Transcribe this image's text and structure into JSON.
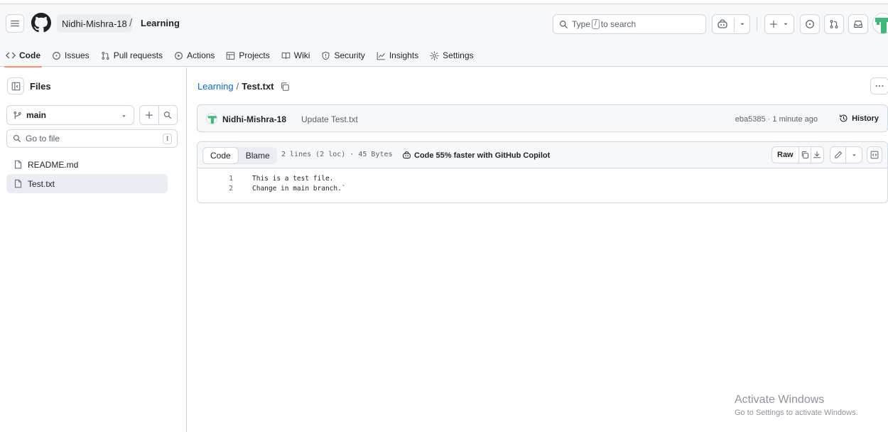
{
  "header": {
    "owner": "Nidhi-Mishra-18",
    "separator": "/",
    "repo": "Learning",
    "search": {
      "prefix": "Type",
      "key": "/",
      "suffix": "to search"
    },
    "icons": [
      "hamburger-icon",
      "github-logo",
      "search-icon",
      "copilot-icon",
      "plus-icon",
      "issue-icon",
      "pull-request-icon",
      "inbox-icon"
    ]
  },
  "tabs": [
    {
      "label": "Code",
      "icon": "code-icon",
      "active": true
    },
    {
      "label": "Issues",
      "icon": "issue-icon"
    },
    {
      "label": "Pull requests",
      "icon": "pull-request-icon"
    },
    {
      "label": "Actions",
      "icon": "play-icon"
    },
    {
      "label": "Projects",
      "icon": "table-icon"
    },
    {
      "label": "Wiki",
      "icon": "book-icon"
    },
    {
      "label": "Security",
      "icon": "shield-icon"
    },
    {
      "label": "Insights",
      "icon": "graph-icon"
    },
    {
      "label": "Settings",
      "icon": "gear-icon"
    }
  ],
  "sidebar": {
    "title": "Files",
    "branch": "main",
    "goto_placeholder": "Go to file",
    "goto_key": "t",
    "files": [
      {
        "name": "README.md",
        "selected": false
      },
      {
        "name": "Test.txt",
        "selected": true
      }
    ]
  },
  "file": {
    "repo_link": "Learning",
    "separator": "/",
    "name": "Test.txt"
  },
  "commit": {
    "author": "Nidhi-Mishra-18",
    "message": "Update Test.txt",
    "meta": "eba5385 · 1 minute ago",
    "history_label": "History"
  },
  "code_view": {
    "tab_code": "Code",
    "tab_blame": "Blame",
    "info": "2 lines (2 loc) · 45 Bytes",
    "copilot_promo": "Code 55% faster with GitHub Copilot",
    "raw_label": "Raw",
    "lines": [
      {
        "num": "1",
        "text": "This is a test file."
      },
      {
        "num": "2",
        "text": "Change in main branch.`"
      }
    ]
  },
  "watermark": {
    "title": "Activate Windows",
    "subtitle": "Go to Settings to activate Windows."
  },
  "colors": {
    "accent_link": "#0969da",
    "tab_underline": "#fd8c73",
    "border": "#d0d7de",
    "muted_text": "#59636e",
    "avatar_green": "#3fb97a"
  }
}
